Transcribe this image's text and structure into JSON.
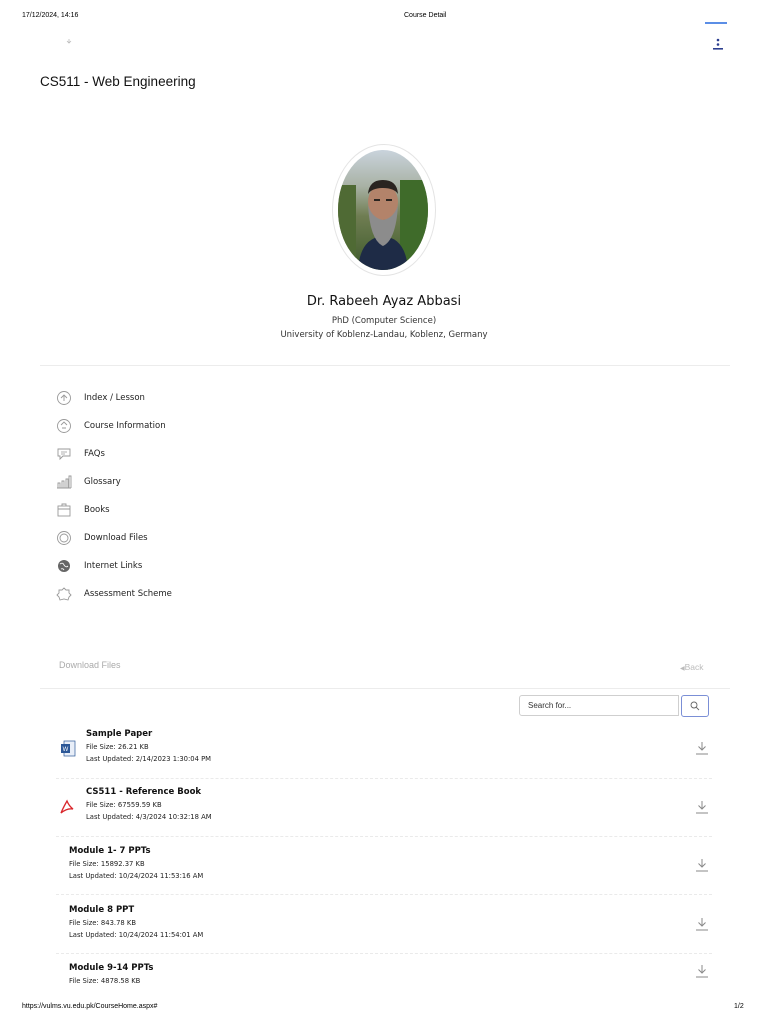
{
  "print": {
    "datetime": "17/12/2024, 14:16",
    "page_title": "Course Detail",
    "url": "https://vulms.vu.edu.pk/CourseHome.aspx#",
    "page_number": "1/2"
  },
  "course": {
    "title": "CS511 - Web Engineering"
  },
  "instructor": {
    "name": "Dr. Rabeeh Ayaz Abbasi",
    "degree": "PhD (Computer Science)",
    "university": "University of Koblenz-Landau, Koblenz, Germany"
  },
  "menu": [
    {
      "label": "Index / Lesson",
      "icon": "lesson-icon"
    },
    {
      "label": "Course Information",
      "icon": "info-icon"
    },
    {
      "label": "FAQs",
      "icon": "chat-icon"
    },
    {
      "label": "Glossary",
      "icon": "bar-chart-icon"
    },
    {
      "label": "Books",
      "icon": "box-icon"
    },
    {
      "label": "Download Files",
      "icon": "download-circle-icon"
    },
    {
      "label": "Internet Links",
      "icon": "globe-icon"
    },
    {
      "label": "Assessment Scheme",
      "icon": "assessment-icon"
    }
  ],
  "downloads": {
    "title": "Download Files",
    "back_label": "Back",
    "search_placeholder": "Search for...",
    "files": [
      {
        "name": "Sample Paper",
        "size": "File Size: 26.21 KB",
        "updated": "Last Updated: 2/14/2023 1:30:04 PM",
        "type_icon": "word-doc-icon"
      },
      {
        "name": "CS511 - Reference Book",
        "size": "File Size: 67559.59 KB",
        "updated": "Last Updated: 4/3/2024 10:32:18 AM",
        "type_icon": "pdf-icon"
      },
      {
        "name": "Module 1- 7 PPTs",
        "size": "File Size: 15892.37 KB",
        "updated": "Last Updated: 10/24/2024 11:53:16 AM",
        "type_icon": ""
      },
      {
        "name": "Module 8 PPT",
        "size": "File Size: 843.78 KB",
        "updated": "Last Updated: 10/24/2024 11:54:01 AM",
        "type_icon": ""
      },
      {
        "name": "Module 9-14 PPTs",
        "size": "File Size: 4878.58 KB",
        "updated": "",
        "type_icon": ""
      }
    ]
  },
  "colors": {
    "word": "#2b5797",
    "pdf": "#d9262b",
    "accent": "#4169e1"
  }
}
